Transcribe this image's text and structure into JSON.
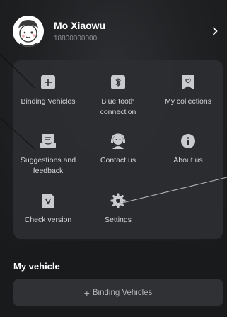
{
  "user": {
    "name": "Mo Xiaowu",
    "phone": "18800000000"
  },
  "menu": {
    "items": [
      {
        "label": "Binding Vehicles",
        "icon": "plus-square-icon"
      },
      {
        "label": "Blue tooth connection",
        "icon": "bluetooth-icon"
      },
      {
        "label": "My collections",
        "icon": "bookmark-heart-icon"
      },
      {
        "label": "Suggestions and feedback",
        "icon": "feedback-inbox-icon"
      },
      {
        "label": "Contact us",
        "icon": "headset-icon"
      },
      {
        "label": "About us",
        "icon": "info-icon"
      },
      {
        "label": "Check version",
        "icon": "version-file-icon"
      },
      {
        "label": "Settings",
        "icon": "gear-icon"
      }
    ]
  },
  "my_vehicle": {
    "title": "My vehicle",
    "bind_button": {
      "plus": "+",
      "label": "Binding Vehicles"
    }
  },
  "colors": {
    "background": "#191a1b",
    "card": "#2c2e31",
    "icon_fill": "#c9cbce",
    "text_muted": "#8d8f93"
  }
}
